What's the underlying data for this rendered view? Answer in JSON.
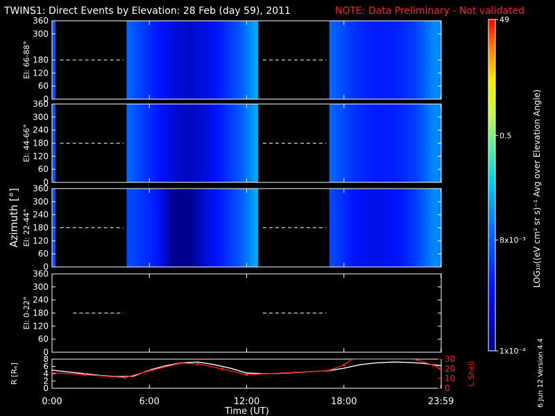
{
  "title": {
    "main": "TWINS1: Direct Events by Elevation: 28 Feb (day  59), 2011",
    "note": "NOTE: Data Preliminary - Not validated"
  },
  "colors": {
    "background": "#000000",
    "axes": "#ffffff",
    "note": "#ff2020",
    "lshell": "#ff1f1f",
    "radius": "#ffffff"
  },
  "y_axis_label": "Azimuth [°]",
  "x_axis_label": "Time (UT)",
  "x_tick_labels": [
    "0:00",
    "6:00",
    "12:00",
    "18:00",
    "23:59"
  ],
  "x_ticks_hours": [
    0,
    6,
    12,
    18,
    23.983
  ],
  "colorbar": {
    "label": "LOG₁₀((eV cm² sr s)⁻¹ Avg over Elevation Angle)",
    "tick_labels": [
      "49",
      "0.5",
      "8x10⁻³",
      "1x10⁻⁴"
    ],
    "tick_values": [
      49,
      0.5,
      0.008,
      0.0001
    ],
    "min": 0.0001,
    "max": 49,
    "scale": "log"
  },
  "side_note": "6 Jun 12   Version 4.4",
  "chart_data": [
    {
      "type": "heatmap",
      "panel": "El: 66-88°",
      "ylabel": "El: 66-88°",
      "y_ticks": [
        0,
        60,
        120,
        180,
        300,
        360
      ],
      "ylim": [
        0,
        360
      ],
      "xlim": [
        0,
        24
      ],
      "data_intervals_hours": [
        [
          0,
          0.2
        ],
        [
          4.6,
          12.7
        ],
        [
          17.1,
          24
        ]
      ],
      "gap_marker_y": 180,
      "flux_by_hour": [
        [
          0.05,
          0.006
        ],
        [
          4.7,
          0.01
        ],
        [
          5.5,
          0.004
        ],
        [
          6.5,
          0.0015
        ],
        [
          7.5,
          0.0006
        ],
        [
          8.5,
          0.0004
        ],
        [
          9.5,
          0.0007
        ],
        [
          10.5,
          0.002
        ],
        [
          11.5,
          0.006
        ],
        [
          12.6,
          0.04
        ],
        [
          17.2,
          0.01
        ],
        [
          18.5,
          0.003
        ],
        [
          20,
          0.0015
        ],
        [
          21.5,
          0.002
        ],
        [
          22.5,
          0.004
        ],
        [
          23.5,
          0.02
        ]
      ]
    },
    {
      "type": "heatmap",
      "panel": "El: 44-66°",
      "ylabel": "El: 44-66°",
      "y_ticks": [
        0,
        60,
        120,
        180,
        240,
        300,
        360
      ],
      "ylim": [
        0,
        360
      ],
      "xlim": [
        0,
        24
      ],
      "data_intervals_hours": [
        [
          0,
          0.2
        ],
        [
          4.6,
          12.7
        ],
        [
          17.1,
          24
        ]
      ],
      "gap_marker_y": 180,
      "flux_by_hour": [
        [
          0.05,
          0.006
        ],
        [
          4.7,
          0.01
        ],
        [
          5.5,
          0.004
        ],
        [
          6.5,
          0.0015
        ],
        [
          7.5,
          0.0005
        ],
        [
          8.5,
          0.0003
        ],
        [
          9.5,
          0.0006
        ],
        [
          10.5,
          0.002
        ],
        [
          11.5,
          0.006
        ],
        [
          12.6,
          0.04
        ],
        [
          17.2,
          0.01
        ],
        [
          18.5,
          0.003
        ],
        [
          20,
          0.0015
        ],
        [
          21.5,
          0.002
        ],
        [
          22.5,
          0.004
        ],
        [
          23.5,
          0.02
        ]
      ]
    },
    {
      "type": "heatmap",
      "panel": "El: 22-44°",
      "ylabel": "El: 22-44°",
      "y_ticks": [
        0,
        60,
        120,
        180,
        240,
        300,
        360
      ],
      "ylim": [
        0,
        360
      ],
      "xlim": [
        0,
        24
      ],
      "data_intervals_hours": [
        [
          0,
          0.2
        ],
        [
          4.6,
          12.7
        ],
        [
          17.1,
          24
        ]
      ],
      "gap_marker_y": 180,
      "flux_by_hour": [
        [
          0.05,
          0.006
        ],
        [
          4.7,
          0.005
        ],
        [
          5.5,
          0.003
        ],
        [
          6.5,
          0.0015
        ],
        [
          7.5,
          0.0001
        ],
        [
          8.5,
          0.0001
        ],
        [
          9.5,
          0.0006
        ],
        [
          10.5,
          0.002
        ],
        [
          11.5,
          0.006
        ],
        [
          12.6,
          0.04
        ],
        [
          17.2,
          0.005
        ],
        [
          18.5,
          0.0015
        ],
        [
          20,
          0.0008
        ],
        [
          21.5,
          0.0015
        ],
        [
          22.5,
          0.004
        ],
        [
          23.5,
          0.02
        ]
      ]
    },
    {
      "type": "heatmap",
      "panel": "El: 0-22°",
      "ylabel": "El: 0-22°",
      "y_ticks": [
        0,
        60,
        120,
        180,
        240,
        300,
        360
      ],
      "ylim": [
        0,
        360
      ],
      "xlim": [
        0,
        24
      ],
      "data_intervals_hours": [],
      "gap_marker_y": 180,
      "flux_by_hour": []
    },
    {
      "type": "line",
      "panel": "orbit",
      "xlim": [
        0,
        24
      ],
      "left_axis": {
        "label": "R [Rₑ]",
        "ticks": [
          0,
          2,
          4,
          6,
          8
        ],
        "ylim": [
          0,
          8
        ]
      },
      "right_axis": {
        "label": "L Shell",
        "ticks": [
          0,
          10,
          20,
          30
        ],
        "ylim": [
          0,
          30
        ]
      },
      "series": [
        {
          "name": "R [Rₑ]",
          "axis": "left",
          "x": [
            0,
            1,
            2,
            3,
            4,
            5,
            6,
            7,
            8,
            9,
            10,
            11,
            12,
            13,
            14,
            15,
            16,
            17,
            18,
            19,
            20,
            21,
            22,
            23,
            23.98
          ],
          "y": [
            5.0,
            4.5,
            4.0,
            3.5,
            3.2,
            3.3,
            5.0,
            6.2,
            7.0,
            7.2,
            6.5,
            5.5,
            4.2,
            4.0,
            4.1,
            4.3,
            4.6,
            4.8,
            5.5,
            6.5,
            7.0,
            7.2,
            7.1,
            6.8,
            6.2
          ]
        },
        {
          "name": "L Shell",
          "axis": "right",
          "x": [
            0,
            2,
            4.5,
            6,
            8,
            9,
            10.5,
            12,
            17,
            18,
            18.5,
            22.3,
            23.5,
            23.98
          ],
          "y": [
            16,
            14,
            11,
            18,
            26,
            25,
            20,
            14,
            18,
            24,
            30,
            30,
            24,
            20
          ]
        }
      ]
    }
  ]
}
